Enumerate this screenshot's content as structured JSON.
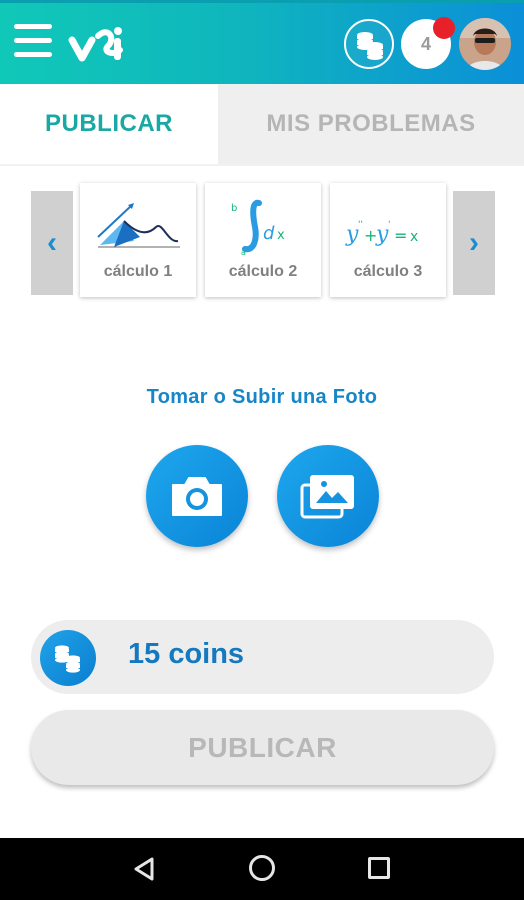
{
  "header": {
    "notification_count": "4",
    "icons": {
      "menu": "menu-icon",
      "logo": "app-logo-icon",
      "coins": "coins-stack-icon",
      "avatar": "user-avatar"
    },
    "colors": {
      "bar_start": "#10c8b8",
      "bar_end": "#0b8fd8",
      "notification_dot": "#e8202a"
    }
  },
  "tabs": [
    {
      "label": "PUBLICAR",
      "active": true
    },
    {
      "label": "MIS PROBLEMAS",
      "active": false
    }
  ],
  "categories": {
    "prev_icon": "chevron-left-icon",
    "next_icon": "chevron-right-icon",
    "items": [
      {
        "label": "cálculo 1",
        "icon": "graph-curve-icon"
      },
      {
        "label": "cálculo 2",
        "icon": "integral-icon"
      },
      {
        "label": "cálculo 3",
        "icon": "differential-equation-icon"
      }
    ]
  },
  "photo": {
    "title": "Tomar o Subir una Foto",
    "camera_icon": "camera-icon",
    "gallery_icon": "gallery-icon"
  },
  "coins": {
    "label": "15 coins",
    "icon": "coins-stack-icon"
  },
  "publish_button": {
    "label": "PUBLICAR",
    "enabled": false
  },
  "navbar": {
    "back_icon": "back-icon",
    "home_icon": "home-icon",
    "recent_icon": "recent-apps-icon"
  }
}
